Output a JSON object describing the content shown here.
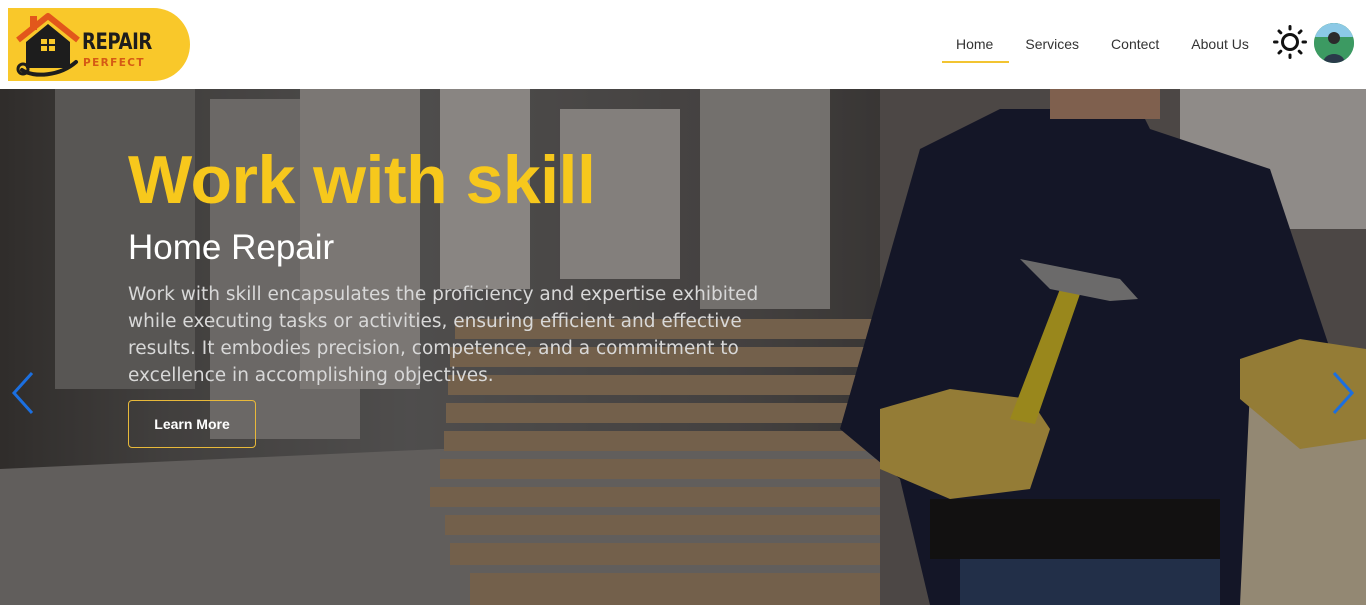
{
  "brand": {
    "title": "REPAIR",
    "subtitle": "PERFECT"
  },
  "nav": {
    "items": [
      {
        "label": "Home",
        "active": true
      },
      {
        "label": "Services",
        "active": false
      },
      {
        "label": "Contect",
        "active": false
      },
      {
        "label": "About Us",
        "active": false
      }
    ],
    "theme_toggle_icon": "sun-icon",
    "avatar_icon": "user-avatar"
  },
  "hero": {
    "title": "Work with skill",
    "subtitle": "Home Repair",
    "description": "Work with skill encapsulates the proficiency and expertise exhibited while executing tasks or activities, ensuring efficient and effective results. It embodies precision, competence, and a commitment to excellence in accomplishing objectives.",
    "button_label": "Learn More",
    "prev_icon": "chevron-left-icon",
    "next_icon": "chevron-right-icon"
  },
  "colors": {
    "accent": "#f9c82a",
    "title": "#f7c81c",
    "arrow": "#1b6fe0"
  }
}
